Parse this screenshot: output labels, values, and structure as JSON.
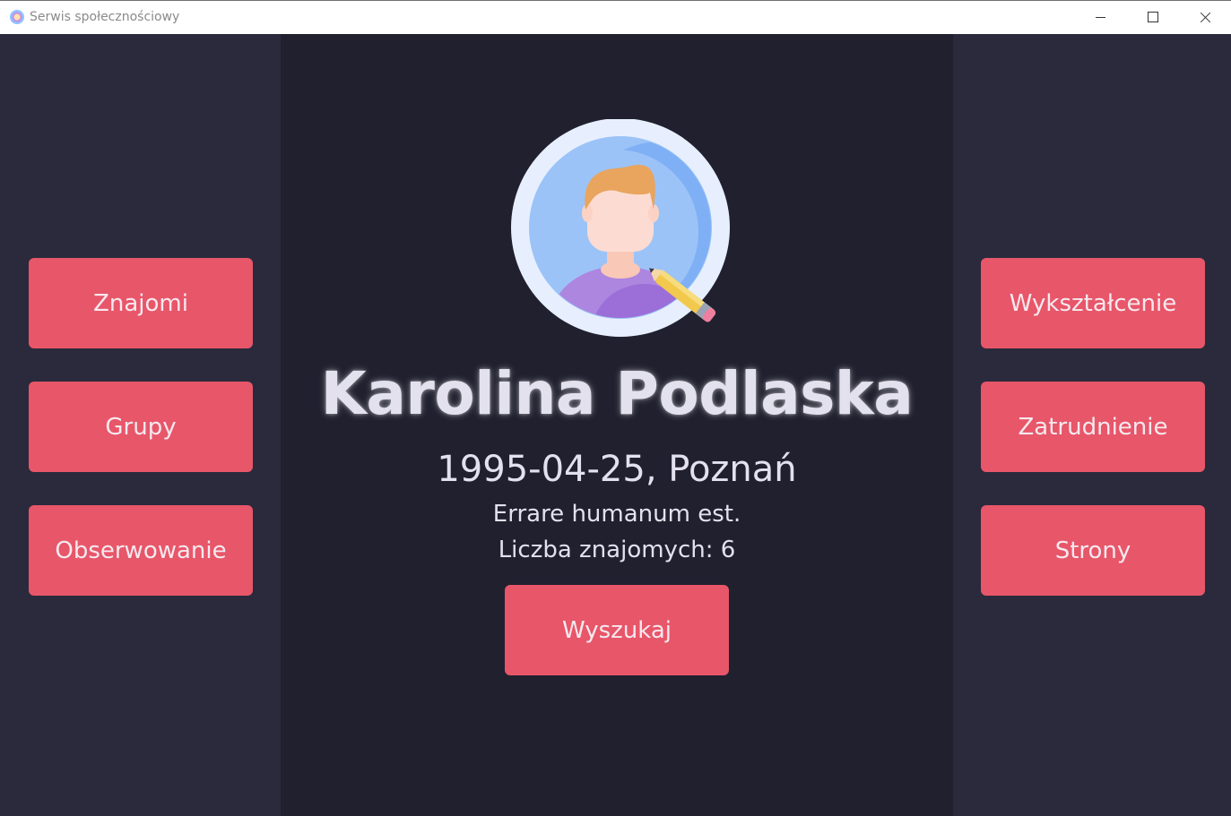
{
  "window": {
    "title": "Serwis społecznościowy"
  },
  "left_nav": {
    "friends_label": "Znajomi",
    "groups_label": "Grupy",
    "following_label": "Obserwowanie"
  },
  "right_nav": {
    "education_label": "Wykształcenie",
    "employment_label": "Zatrudnienie",
    "pages_label": "Strony"
  },
  "profile": {
    "avatar_icon": "user-avatar-edit-icon",
    "name": "Karolina Podlaska",
    "birth_and_city": "1995-04-25, Poznań",
    "motto": "Errare humanum est.",
    "friends_count": "Liczba znajomych: 6"
  },
  "actions": {
    "search_label": "Wyszukaj"
  },
  "colors": {
    "button": "#e85669",
    "button_text": "#f5e9ef",
    "side_background": "#2a2a3c",
    "center_background": "#20202f",
    "text": "#e4e1ee"
  }
}
